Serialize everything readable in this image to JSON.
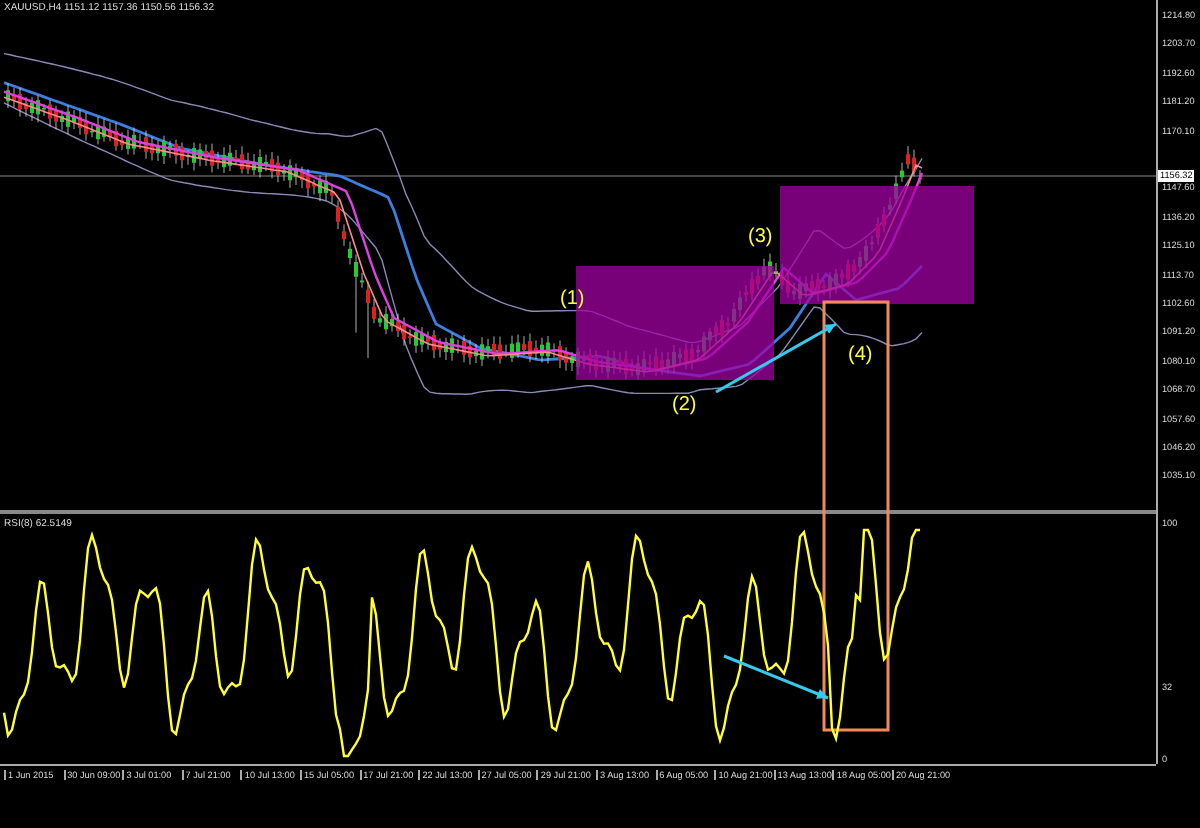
{
  "chart_header": {
    "symbol_line": "XAUUSD,H4 1151.12 1157.36 1150.56 1156.32"
  },
  "price_axis": {
    "labels": [
      "1214.80",
      "1203.70",
      "1192.60",
      "1181.20",
      "1170.10",
      "1147.60",
      "1136.20",
      "1125.10",
      "1113.70",
      "1102.60",
      "1091.20",
      "1080.10",
      "1068.70",
      "1057.60",
      "1046.20",
      "1035.10"
    ],
    "current_price": "1156.32"
  },
  "indicator": {
    "label": "RSI(8) 62.5149",
    "axis_labels": [
      "100",
      "32",
      "0"
    ]
  },
  "annotations": [
    {
      "text": "(1)"
    },
    {
      "text": "(2)"
    },
    {
      "text": "(3)"
    },
    {
      "text": "(4)"
    }
  ],
  "time_axis": {
    "labels": [
      "1 Jun 2015",
      "30 Jun 09:00",
      "3 Jul 01:00",
      "7 Jul 21:00",
      "10 Jul 13:00",
      "15 Jul 05:00",
      "17 Jul 21:00",
      "22 Jul 13:00",
      "27 Jul 05:00",
      "29 Jul 21:00",
      "3 Aug 13:00",
      "6 Aug 05:00",
      "10 Aug 21:00",
      "13 Aug 13:00",
      "18 Aug 05:00",
      "20 Aug 21:00"
    ]
  }
}
